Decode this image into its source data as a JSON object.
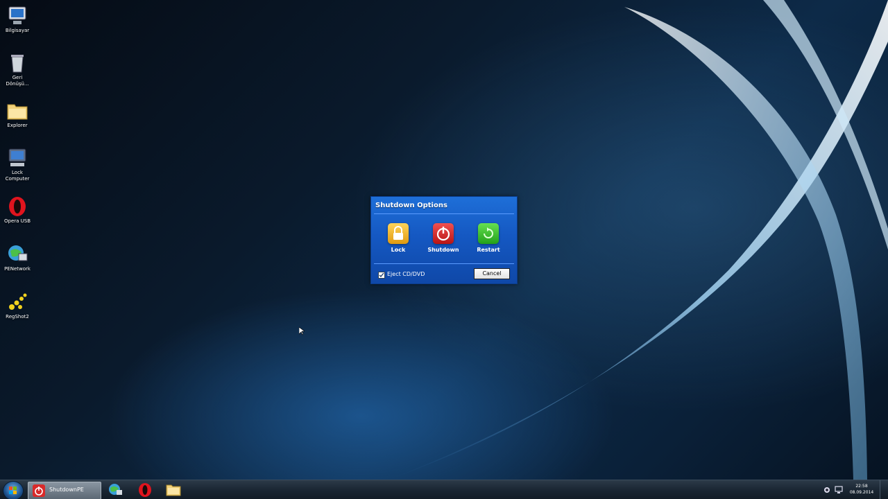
{
  "desktop_icons": [
    {
      "name": "computer-icon",
      "label": "Bilgisayar"
    },
    {
      "name": "recycle-bin-icon",
      "label": "Geri Dönüşü..."
    },
    {
      "name": "explorer-icon",
      "label": "Explorer"
    },
    {
      "name": "lock-computer-icon",
      "label": "Lock Computer"
    },
    {
      "name": "opera-icon",
      "label": "Opera USB"
    },
    {
      "name": "network-icon",
      "label": "PENetwork"
    },
    {
      "name": "regshot-icon",
      "label": "RegShot2"
    }
  ],
  "dialog": {
    "title": "Shutdown Options",
    "options": [
      {
        "label": "Lock",
        "icon": "lock-icon",
        "color": "#f2b01e"
      },
      {
        "label": "Shutdown",
        "icon": "power-icon",
        "color": "#d92a2a"
      },
      {
        "label": "Restart",
        "icon": "restart-icon",
        "color": "#3cbf2e"
      }
    ],
    "eject_label": "Eject CD/DVD",
    "eject_checked": true,
    "cancel_label": "Cancel"
  },
  "taskbar": {
    "active_label": "ShutdownPE",
    "clock_time": "22:58",
    "clock_date": "08.09.2014"
  }
}
